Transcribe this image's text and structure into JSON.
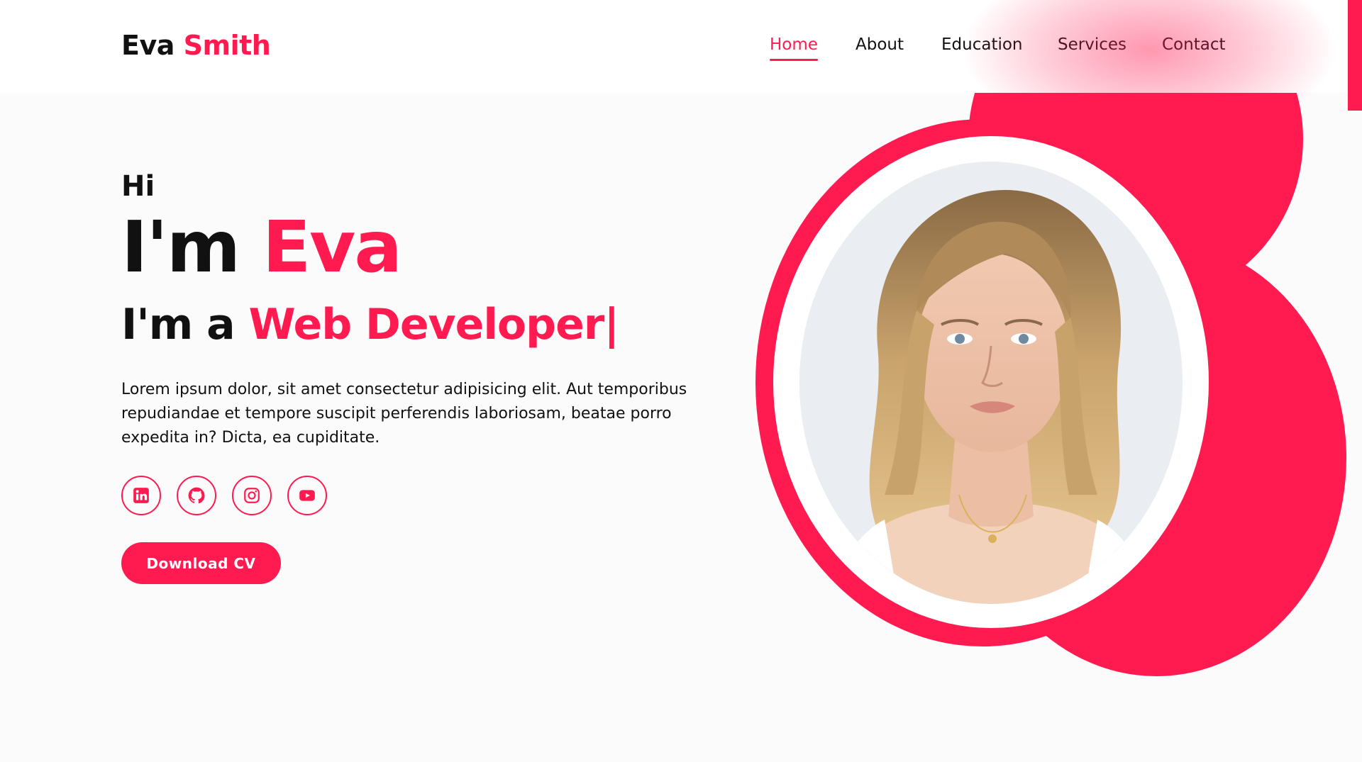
{
  "header": {
    "logo_first": "Eva",
    "logo_last": "Smith",
    "nav": [
      {
        "label": "Home",
        "active": true
      },
      {
        "label": "About",
        "active": false
      },
      {
        "label": "Education",
        "active": false
      },
      {
        "label": "Services",
        "active": false
      },
      {
        "label": "Contact",
        "active": false
      }
    ]
  },
  "hero": {
    "greeting": "Hi",
    "im_prefix": "I'm",
    "name": "Eva",
    "role_prefix": "I'm a",
    "role": "Web Developer",
    "cursor": "|",
    "description": "Lorem ipsum dolor, sit amet consectetur adipisicing elit. Aut temporibus repudiandae et tempore suscipit perferendis laboriosam, beatae porro expedita in? Dicta, ea cupiditate.",
    "socials": [
      "linkedin-icon",
      "github-icon",
      "instagram-icon",
      "youtube-icon"
    ],
    "cta_label": "Download CV"
  },
  "colors": {
    "accent": "#ff1a4f",
    "background": "#fbfbfc",
    "text": "#111111"
  }
}
